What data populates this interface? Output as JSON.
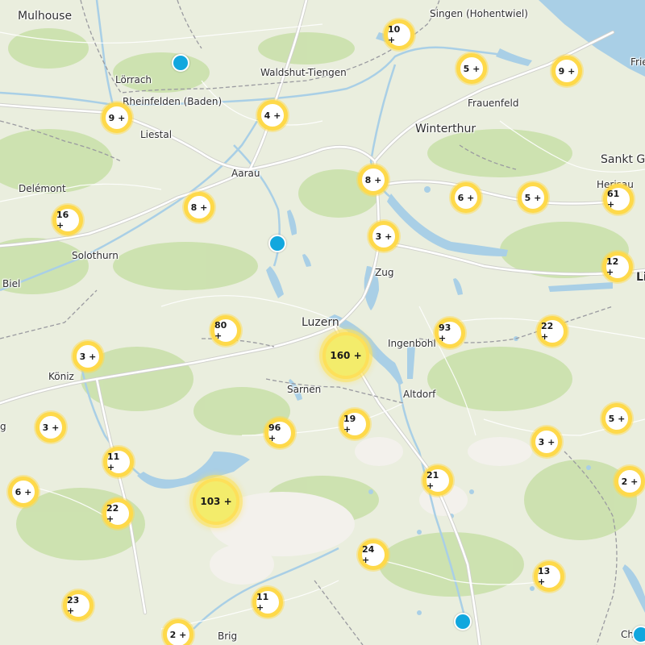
{
  "places": [
    {
      "id": "mulhouse",
      "name": "Mulhouse",
      "size": "big"
    },
    {
      "id": "singen",
      "name": "Singen (Hohentwiel)"
    },
    {
      "id": "frie",
      "name": "Frie"
    },
    {
      "id": "waldshut",
      "name": "Waldshut-Tiengen"
    },
    {
      "id": "loerrach",
      "name": "Lörrach"
    },
    {
      "id": "rheinfelden",
      "name": "Rheinfelden (Baden)"
    },
    {
      "id": "frauenfeld",
      "name": "Frauenfeld"
    },
    {
      "id": "liestal",
      "name": "Liestal"
    },
    {
      "id": "winterthur",
      "name": "Winterthur",
      "size": "big"
    },
    {
      "id": "sanktgallen",
      "name": "Sankt Ga",
      "size": "big"
    },
    {
      "id": "aarau",
      "name": "Aarau"
    },
    {
      "id": "delemont",
      "name": "Delémont"
    },
    {
      "id": "herisau",
      "name": "Herisau"
    },
    {
      "id": "solothurn",
      "name": "Solothurn"
    },
    {
      "id": "zug",
      "name": "Zug"
    },
    {
      "id": "biel",
      "name": "Biel"
    },
    {
      "id": "li",
      "name": "Li",
      "size": "big",
      "weight": "bold"
    },
    {
      "id": "luzern",
      "name": "Luzern",
      "size": "big"
    },
    {
      "id": "ingenbohl",
      "name": "Ingenbohl"
    },
    {
      "id": "koeniz",
      "name": "Köniz"
    },
    {
      "id": "sarnen",
      "name": "Sarnen"
    },
    {
      "id": "altdorf",
      "name": "Altdorf"
    },
    {
      "id": "g",
      "name": "g"
    },
    {
      "id": "brig",
      "name": "Brig"
    },
    {
      "id": "ch",
      "name": "Ch"
    }
  ],
  "clusters": [
    {
      "id": "c10",
      "label": "10 +"
    },
    {
      "id": "c5a",
      "label": "5 +"
    },
    {
      "id": "c9a",
      "label": "9 +"
    },
    {
      "id": "c9b",
      "label": "9 +"
    },
    {
      "id": "c4",
      "label": "4 +"
    },
    {
      "id": "c8a",
      "label": "8 +"
    },
    {
      "id": "c6a",
      "label": "6 +"
    },
    {
      "id": "c5b",
      "label": "5 +"
    },
    {
      "id": "c61",
      "label": "61 +"
    },
    {
      "id": "c16",
      "label": "16 +"
    },
    {
      "id": "c8b",
      "label": "8 +"
    },
    {
      "id": "c3a",
      "label": "3 +"
    },
    {
      "id": "c12",
      "label": "12 +"
    },
    {
      "id": "c80",
      "label": "80 +"
    },
    {
      "id": "c93",
      "label": "93 +"
    },
    {
      "id": "c22a",
      "label": "22 +"
    },
    {
      "id": "c3b",
      "label": "3 +"
    },
    {
      "id": "c160",
      "label": "160 +",
      "size": "large"
    },
    {
      "id": "c3c",
      "label": "3 +"
    },
    {
      "id": "c96",
      "label": "96 +"
    },
    {
      "id": "c19",
      "label": "19 +"
    },
    {
      "id": "c5c",
      "label": "5 +"
    },
    {
      "id": "c3d",
      "label": "3 +"
    },
    {
      "id": "c11a",
      "label": "11 +"
    },
    {
      "id": "c21",
      "label": "21 +"
    },
    {
      "id": "c2a",
      "label": "2 +"
    },
    {
      "id": "c6b",
      "label": "6 +"
    },
    {
      "id": "c22b",
      "label": "22 +"
    },
    {
      "id": "c103",
      "label": "103 +",
      "size": "large"
    },
    {
      "id": "c24",
      "label": "24 +"
    },
    {
      "id": "c13",
      "label": "13 +"
    },
    {
      "id": "c23",
      "label": "23 +"
    },
    {
      "id": "c11b",
      "label": "11 +"
    },
    {
      "id": "c2b",
      "label": "2 +"
    }
  ],
  "markers": [
    {
      "id": "m1"
    },
    {
      "id": "m2"
    },
    {
      "id": "m3"
    },
    {
      "id": "m4"
    }
  ],
  "colors": {
    "land": "#eaeede",
    "forest": "#c5dea4",
    "alpine": "#f2f0ea",
    "water": "#a9cfe6",
    "road": "#ffffff",
    "border": "#9a9aa0",
    "cluster_ring": "#fed94a",
    "cluster_large_fill": "#f3ec6b",
    "marker": "#11a7de"
  }
}
